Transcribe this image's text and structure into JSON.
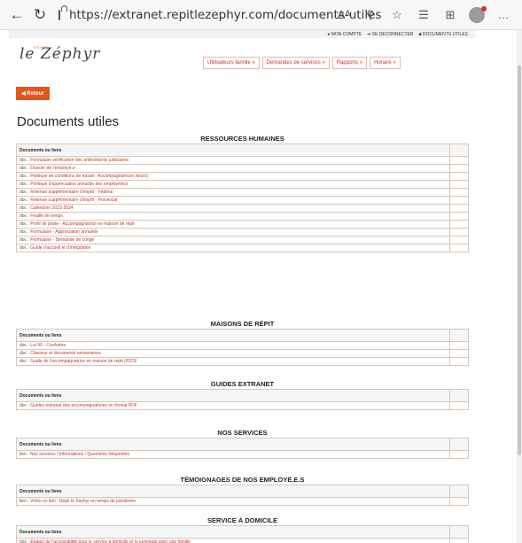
{
  "browser": {
    "url": "https://extranet.repitlezephyr.com/documents-utiles",
    "reader_label": "Aᴬ"
  },
  "topbar": {
    "account": "MON COMPTE",
    "logout": "SE DÉCONNECTER",
    "docs": "DOCUMENTS UTILES"
  },
  "logo": {
    "small": "RÉPIT",
    "main": "le Zéphyr"
  },
  "menu": [
    "Utilisateurs famille »",
    "Demandes de services »",
    "Rapports »",
    "Horaire »"
  ],
  "back_label": "Retour",
  "page_title": "Documents utiles",
  "col_header": "Documents ou liens",
  "sections": [
    {
      "title": "RESSOURCES HUMAINES",
      "rows": [
        {
          "prefix": "doc :",
          "text": "Formulaire vérification des antécédents judiciaires"
        },
        {
          "prefix": "doc :",
          "text": "Dossier de l'employé.e"
        },
        {
          "prefix": "doc :",
          "text": "Politique de conditions de travail - Accompagnatrices (teurs)"
        },
        {
          "prefix": "doc :",
          "text": "Politique d'appréciation annuelle des employé(e)s"
        },
        {
          "prefix": "doc :",
          "text": "Retenue supplémentaire d'impôt - Fédéral"
        },
        {
          "prefix": "doc :",
          "text": "Retenue supplémentaire d'impôt - Provincial"
        },
        {
          "prefix": "doc :",
          "text": "Calendrier 2023-2024"
        },
        {
          "prefix": "doc :",
          "text": "Feuille de temps"
        },
        {
          "prefix": "doc :",
          "text": "Profil de poste - Accompagnatrice en maison de répit"
        },
        {
          "prefix": "doc :",
          "text": "Formulaire - Appréciation annuelle"
        },
        {
          "prefix": "doc :",
          "text": "Formulaire - Demande de congé"
        },
        {
          "prefix": "doc :",
          "text": "Guide d'accueil et d'intégration"
        }
      ]
    },
    {
      "title": "MAISONS DE RÉPIT",
      "rows": [
        {
          "prefix": "doc :",
          "text": "Loi 90 - Conforme"
        },
        {
          "prefix": "doc :",
          "text": "Classeur et documents nécessaires"
        },
        {
          "prefix": "doc :",
          "text": "Guide de l'accompagnatrice en maison de répit (2023)"
        }
      ]
    },
    {
      "title": "GUIDES EXTRANET",
      "rows": [
        {
          "prefix": "doc :",
          "text": "Guides extranet des accompagnatrices en format PDF"
        }
      ]
    },
    {
      "title": "NOS SERVICES",
      "rows": [
        {
          "prefix": "lien :",
          "text": "Nos services / Informations / Questions fréquentes"
        }
      ]
    },
    {
      "title": "TÉMOIGNAGES DE NOS EMPLOYÉ.E.S",
      "rows": [
        {
          "prefix": "lien :",
          "text": "Vidéo en lien : Répit le Zéphyr en temps de pandémie"
        }
      ]
    },
    {
      "title": "SERVICE À DOMICILE",
      "rows": [
        {
          "prefix": "doc :",
          "text": "Étapes de l'accessibilité pour le service à domicile et le jumelage avec une famille"
        }
      ]
    }
  ]
}
